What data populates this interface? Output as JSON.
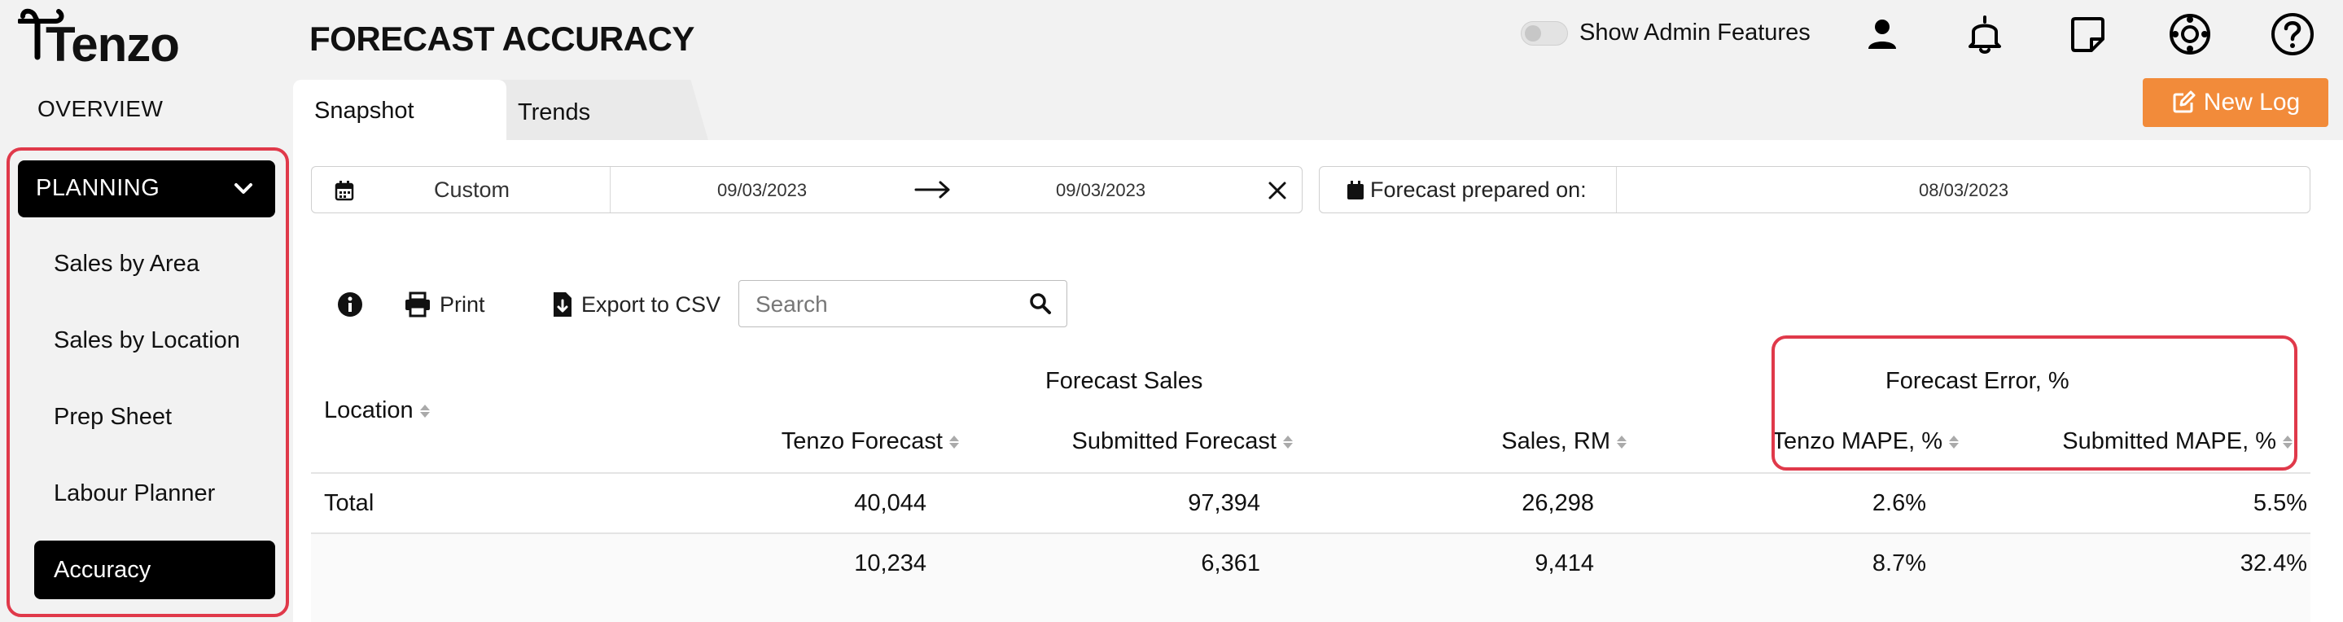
{
  "app": {
    "logo_text": "Tenzo"
  },
  "header": {
    "title": "FORECAST ACCURACY",
    "admin_toggle_label": "Show Admin Features",
    "admin_toggle_on": false,
    "icons": [
      "user-icon",
      "bell-icon",
      "note-icon",
      "support-icon",
      "help-icon"
    ]
  },
  "sidebar": {
    "overview": "OVERVIEW",
    "section": {
      "label": "PLANNING",
      "expanded": true
    },
    "items": [
      {
        "label": "Sales by Area",
        "active": false
      },
      {
        "label": "Sales by Location",
        "active": false
      },
      {
        "label": "Prep Sheet",
        "active": false
      },
      {
        "label": "Labour Planner",
        "active": false
      },
      {
        "label": "Accuracy",
        "active": true
      }
    ]
  },
  "tabs": [
    {
      "label": "Snapshot",
      "active": true
    },
    {
      "label": "Trends",
      "active": false
    }
  ],
  "actions": {
    "new_log": "New Log"
  },
  "filters": {
    "range_type": "Custom",
    "start_date": "09/03/2023",
    "end_date": "09/03/2023",
    "prepared_label": "Forecast prepared on:",
    "prepared_date": "08/03/2023"
  },
  "toolbar": {
    "print": "Print",
    "export": "Export to CSV",
    "search_placeholder": "Search"
  },
  "table": {
    "group_forecast": "Forecast Sales",
    "group_error": "Forecast Error, %",
    "columns": [
      "Location",
      "Tenzo Forecast",
      "Submitted Forecast",
      "Sales, RM",
      "Tenzo MAPE, %",
      "Submitted MAPE, %"
    ],
    "rows": [
      [
        "Total",
        "40,044",
        "97,394",
        "26,298",
        "2.6%",
        "5.5%"
      ],
      [
        "",
        "10,234",
        "6,361",
        "9,414",
        "8.7%",
        "32.4%"
      ]
    ]
  },
  "colors": {
    "accent": "#f28b3a",
    "highlight": "#e0394a",
    "active_bg": "#000000"
  }
}
